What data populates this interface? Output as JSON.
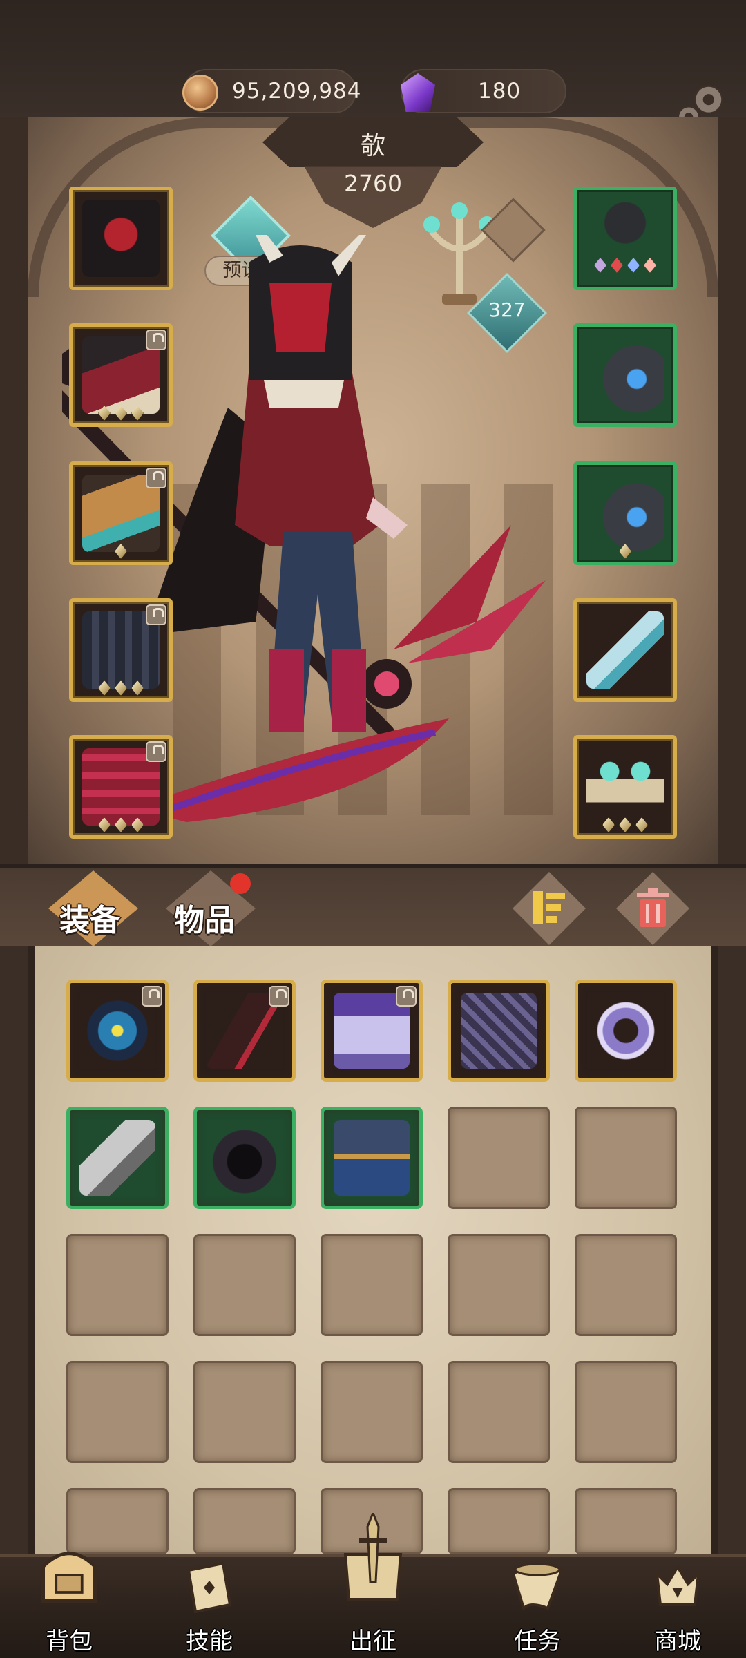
{
  "currency": {
    "gold_icon": "coin-icon",
    "gold": "95,209,984",
    "gem_icon": "purple-crystal-icon",
    "gems": "180"
  },
  "settings_icon": "gear-icon",
  "hero": {
    "name": "欹",
    "power": "2760",
    "preset_label": "预设一",
    "lamp_value": "327"
  },
  "equipped_left": [
    {
      "icon": "hood-helmet-icon",
      "frame": "gold",
      "locked": false,
      "gems": 0
    },
    {
      "icon": "pirate-coat-armor-icon",
      "frame": "gold",
      "locked": true,
      "gems": 3
    },
    {
      "icon": "gold-gauntlet-icon",
      "frame": "gold",
      "locked": true,
      "gems": 1
    },
    {
      "icon": "dark-skirt-icon",
      "frame": "gold",
      "locked": true,
      "gems": 3
    },
    {
      "icon": "crimson-boots-icon",
      "frame": "gold",
      "locked": true,
      "gems": 3
    }
  ],
  "equipped_right": [
    {
      "icon": "gem-necklace-icon",
      "frame": "green",
      "locked": false,
      "gems": 0
    },
    {
      "icon": "eye-ring-icon",
      "frame": "green",
      "locked": false,
      "gems": 0
    },
    {
      "icon": "eye-ring-icon",
      "frame": "green",
      "locked": false,
      "gems": 1
    },
    {
      "icon": "ice-scythe-icon",
      "frame": "gold",
      "locked": false,
      "gems": 0
    },
    {
      "icon": "candelabra-relic-icon",
      "frame": "gold",
      "locked": false,
      "gems": 3
    }
  ],
  "tabs": {
    "equipment": "装备",
    "items": "物品"
  },
  "toolbar": {
    "sort_icon": "sort-icon",
    "trash_icon": "trash-icon"
  },
  "inventory": [
    {
      "icon": "eye-amulet-icon",
      "frame": "gold",
      "locked": true
    },
    {
      "icon": "dark-scythe-icon",
      "frame": "gold",
      "locked": true
    },
    {
      "icon": "violet-armor-icon",
      "frame": "gold",
      "locked": true
    },
    {
      "icon": "thorn-gauntlet-icon",
      "frame": "gold",
      "locked": false
    },
    {
      "icon": "rune-ring-icon",
      "frame": "gold",
      "locked": false
    },
    {
      "icon": "spiked-mace-icon",
      "frame": "green",
      "locked": false
    },
    {
      "icon": "black-hood-icon",
      "frame": "green",
      "locked": false
    },
    {
      "icon": "blue-robe-icon",
      "frame": "green",
      "locked": false
    }
  ],
  "bottom_nav": [
    {
      "label": "背包",
      "icon": "backpack-icon"
    },
    {
      "label": "技能",
      "icon": "skill-book-icon"
    },
    {
      "label": "出征",
      "icon": "crossed-swords-map-icon"
    },
    {
      "label": "任务",
      "icon": "scroll-horn-icon"
    },
    {
      "label": "商城",
      "icon": "shop-crown-icon"
    }
  ],
  "colors": {
    "gold_frame": "#d7ad4c",
    "green_frame": "#3bb063",
    "notification_dot": "#e2342b"
  }
}
